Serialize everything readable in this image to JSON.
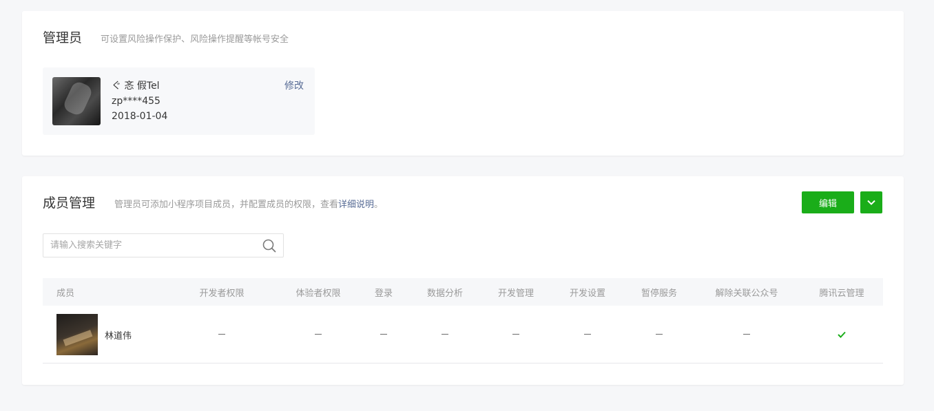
{
  "admin": {
    "title": "管理员",
    "description": "可设置风险操作保护、风险操作提醒等帐号安全",
    "nickname": "ぐ 忞 假Tel",
    "account": "zp****455",
    "date": "2018-01-04",
    "edit_label": "修改"
  },
  "members": {
    "title": "成员管理",
    "description_prefix": "管理员可添加小程序项目成员，并配置成员的权限，查看",
    "description_link": "详细说明",
    "description_suffix": "。",
    "edit_button": "编辑",
    "search_placeholder": "请输入搜索关键字",
    "columns": [
      "成员",
      "开发者权限",
      "体验者权限",
      "登录",
      "数据分析",
      "开发管理",
      "开发设置",
      "暂停服务",
      "解除关联公众号",
      "腾讯云管理"
    ],
    "rows": [
      {
        "name": "林道伟",
        "permissions": [
          "—",
          "—",
          "—",
          "—",
          "—",
          "—",
          "—",
          "—",
          "✔"
        ]
      }
    ]
  },
  "colors": {
    "accent_green": "#1aad19",
    "link_blue": "#576b95",
    "check_green": "#1aad19"
  },
  "icons": {
    "search": "search-icon",
    "dropdown": "chevron-down-icon",
    "check": "check-icon"
  }
}
